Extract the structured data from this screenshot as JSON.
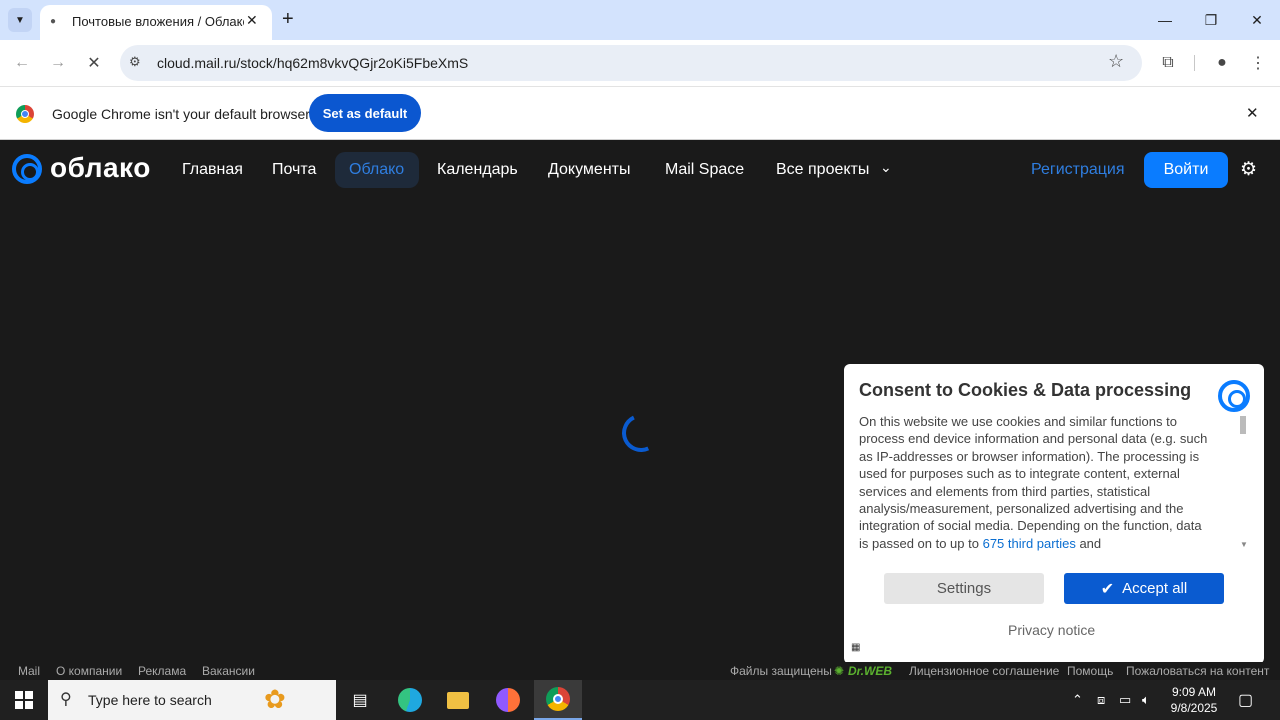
{
  "browser": {
    "tab_title": "Почтовые вложения / Облако",
    "url": "cloud.mail.ru/stock/hq62m8vkvQGjr2oKi5FbeXmS"
  },
  "infobar": {
    "text": "Google Chrome isn't your default browser",
    "button": "Set as default"
  },
  "site": {
    "logo": "облако",
    "nav": [
      "Главная",
      "Почта",
      "Облако",
      "Календарь",
      "Документы",
      "Mail Space",
      "Все проекты"
    ],
    "register": "Регистрация",
    "login": "Войти"
  },
  "cookie": {
    "title": "Consent to Cookies & Data processing",
    "body_before_link": "On this website we use cookies and similar functions to process end device information and personal data (e.g. such as IP-addresses or browser information). The processing is used for purposes such as to integrate content, external services and elements from third parties, statistical analysis/measurement, personalized advertising and the integration of social media. Depending on the function, data is passed on to up to ",
    "link_text": "675 third parties",
    "body_after_link": " and",
    "settings": "Settings",
    "accept": "Accept all",
    "privacy": "Privacy notice"
  },
  "footer": {
    "left": [
      "Mail",
      "О компании",
      "Реклама",
      "Вакансии"
    ],
    "protected": "Файлы защищены",
    "drweb": "Dr.WEB",
    "license": "Лицензионное соглашение",
    "help": "Помощь",
    "report": "Пожаловаться на контент"
  },
  "taskbar": {
    "search_placeholder": "Type here to search",
    "time": "9:09 AM",
    "date": "9/8/2025"
  },
  "colors": {
    "accent": "#0a7cff",
    "chrome_blue": "#0b57d0",
    "page_bg": "#1a1a1a"
  }
}
